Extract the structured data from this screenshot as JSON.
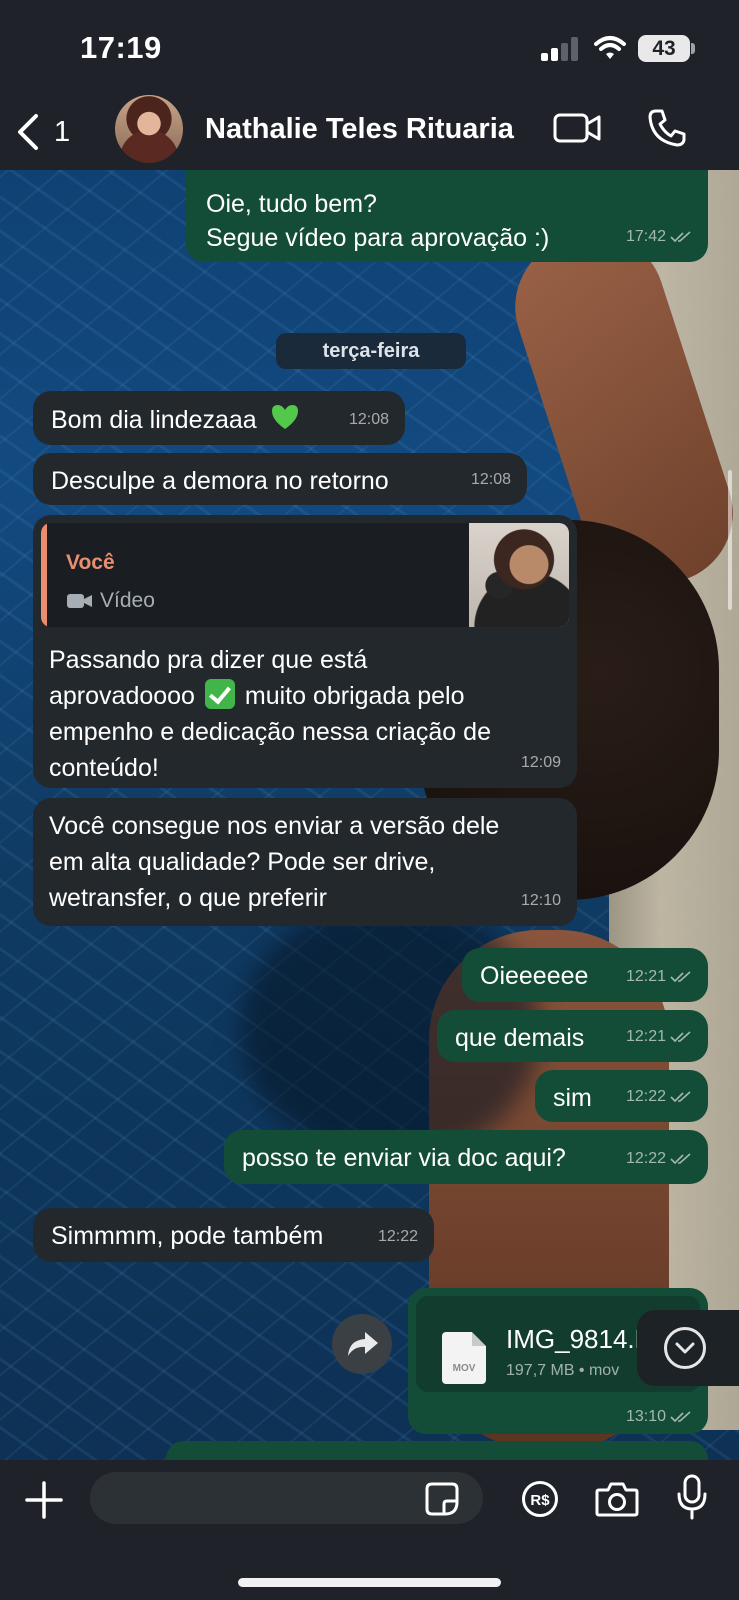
{
  "status_bar": {
    "time": "17:19",
    "battery": "43"
  },
  "header": {
    "back_count": "1",
    "contact_name": "Nathalie Teles Rituaria"
  },
  "messages": {
    "m1": {
      "line1": "Oie, tudo bem?",
      "line2": "Segue vídeo para aprovação :)",
      "time": "17:42"
    },
    "day_separator": "terça-feira",
    "m2": {
      "text": "Bom dia lindezaaa",
      "time": "12:08"
    },
    "m3": {
      "text": "Desculpe a demora no retorno",
      "time": "12:08"
    },
    "m4": {
      "quote_author": "Você",
      "quote_type": "Vídeo",
      "line1": "Passando pra dizer que está",
      "line2a": "aprovadoooo",
      "line2b": "muito obrigada pelo",
      "line3": "empenho e dedicação nessa criação de",
      "line4": "conteúdo!",
      "time": "12:09"
    },
    "m5": {
      "line1": "Você consegue nos enviar a versão dele",
      "line2": "em alta qualidade? Pode ser drive,",
      "line3": "wetransfer, o que preferir",
      "time": "12:10"
    },
    "m6": {
      "text": "Oieeeeee",
      "time": "12:21"
    },
    "m7": {
      "text": "que demais",
      "time": "12:21"
    },
    "m8": {
      "text": "sim",
      "time": "12:22"
    },
    "m9": {
      "text": "posso te enviar via doc aqui?",
      "time": "12:22"
    },
    "m10": {
      "text": "Simmmm, pode também",
      "time": "12:22"
    },
    "doc": {
      "name": "IMG_9814.M",
      "meta": "197,7 MB • mov",
      "icon_label": "MOV",
      "time": "13:10"
    }
  },
  "composer": {
    "input_value": "",
    "input_placeholder": ""
  },
  "colors": {
    "outgoing_bubble": "#144d37",
    "incoming_bubble": "#23282d",
    "quote_accent": "#e98e6f",
    "bar": "#1f2329"
  },
  "icons": [
    "back-chevron-icon",
    "video-camera-icon",
    "phone-icon",
    "double-check-icon",
    "green-heart-icon",
    "check-mark-emoji-icon",
    "video-icon",
    "document-icon",
    "forward-icon",
    "chevron-down-icon",
    "plus-icon",
    "sticker-icon",
    "payment-icon",
    "camera-icon",
    "microphone-icon"
  ]
}
